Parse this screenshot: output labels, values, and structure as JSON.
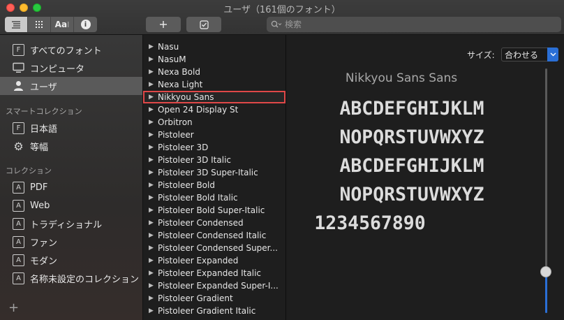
{
  "window": {
    "title": "ユーザ（161個のフォント）"
  },
  "toolbar": {
    "view_modes": [
      {
        "name": "list-view-icon",
        "active": true
      },
      {
        "name": "grid-view-icon",
        "active": false
      },
      {
        "name": "sample-view-icon",
        "label": "Aa",
        "active": false
      },
      {
        "name": "info-icon",
        "label": "i",
        "active": false
      }
    ],
    "add_icon": "plus-icon",
    "enable_icon": "checkbox-icon",
    "search": {
      "placeholder": "検索",
      "value": ""
    }
  },
  "sidebar": {
    "items": [
      {
        "label": "すべてのフォント",
        "icon": "font-box-icon",
        "glyph": "F"
      },
      {
        "label": "コンピュータ",
        "icon": "computer-icon"
      },
      {
        "label": "ユーザ",
        "icon": "user-icon",
        "selected": true
      }
    ],
    "smart_heading": "スマートコレクション",
    "smart_items": [
      {
        "label": "日本語",
        "icon": "font-box-icon",
        "glyph": "F"
      },
      {
        "label": "等幅",
        "icon": "gear-icon"
      }
    ],
    "collections_heading": "コレクション",
    "collections": [
      {
        "label": "PDF",
        "glyph": "A"
      },
      {
        "label": "Web",
        "glyph": "A"
      },
      {
        "label": "トラディショナル",
        "glyph": "A"
      },
      {
        "label": "ファン",
        "glyph": "A"
      },
      {
        "label": "モダン",
        "glyph": "A"
      },
      {
        "label": "名称未設定のコレクション",
        "glyph": "A"
      }
    ],
    "add_label": "+"
  },
  "fonts": [
    "Nasu",
    "NasuM",
    "Nexa Bold",
    "Nexa Light",
    "Nikkyou Sans",
    "Open 24 Display St",
    "Orbitron",
    "Pistoleer",
    "Pistoleer 3D",
    "Pistoleer 3D Italic",
    "Pistoleer 3D Super-Italic",
    "Pistoleer Bold",
    "Pistoleer Bold Italic",
    "Pistoleer Bold Super-Italic",
    "Pistoleer Condensed",
    "Pistoleer Condensed Italic",
    "Pistoleer Condensed Super...",
    "Pistoleer Expanded",
    "Pistoleer Expanded Italic",
    "Pistoleer Expanded Super-I...",
    "Pistoleer Gradient",
    "Pistoleer Gradient Italic"
  ],
  "selected_font_index": 4,
  "preview": {
    "size_label": "サイズ:",
    "size_value": "合わせる",
    "font_name": "Nikkyou Sans Sans",
    "lines": [
      "ABCDEFGHIJKLM",
      "NOPQRSTUVWXYZ",
      "ABCDEFGHIJKLM",
      "NOPQRSTUVWXYZ",
      "1234567890"
    ],
    "slider_level": 0.17
  },
  "colors": {
    "accent": "#2a6fd6",
    "highlight": "#e04848"
  }
}
